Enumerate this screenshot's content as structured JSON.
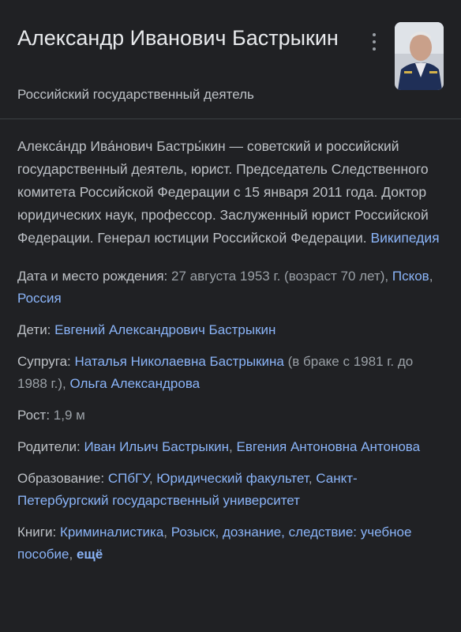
{
  "header": {
    "title": "Александр Иванович Бастрыкин",
    "subtitle": "Российский государственный деятель",
    "menu_icon": "more-vert-icon"
  },
  "description": {
    "text": "Алекса́ндр Ива́нович Бастры́кин — советский и российский государственный деятель, юрист. Председатель Следственного комитета Российской Федерации с 15 января 2011 года. Доктор юридических наук, профессор. Заслуженный юрист Российской Федерации. Генерал юстиции Российской Федерации.",
    "source": "Википедия"
  },
  "facts": {
    "birth": {
      "label": "Дата и место рождения:",
      "date": "27 августа 1953 г. (возраст 70 лет),",
      "place1": "Псков",
      "place2": "Россия"
    },
    "children": {
      "label": "Дети:",
      "link1": "Евгений Александрович Бастрыкин"
    },
    "spouse": {
      "label": "Супруга:",
      "link1": "Наталья Николаевна Бастрыкина",
      "note": "(в браке с 1981 г. до 1988 г.),",
      "link2": "Ольга Александрова"
    },
    "height": {
      "label": "Рост:",
      "value": "1,9 м"
    },
    "parents": {
      "label": "Родители:",
      "link1": "Иван Ильич Бастрыкин",
      "link2": "Евгения Антоновна Антонова"
    },
    "education": {
      "label": "Образование:",
      "link1": "СПбГУ",
      "link2": "Юридический факультет",
      "link3": "Санкт-Петербургский государственный университет"
    },
    "books": {
      "label": "Книги:",
      "link1": "Криминалистика",
      "link2": "Розыск, дознание, следствие: учебное пособие",
      "more": "ещё"
    }
  }
}
